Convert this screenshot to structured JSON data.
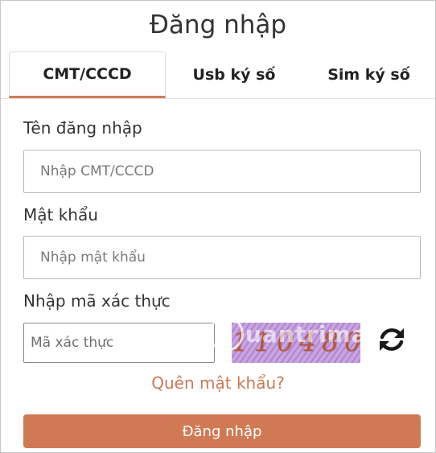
{
  "header": {
    "title": "Đăng nhập"
  },
  "tabs": [
    {
      "label": "CMT/CCCD",
      "active": true
    },
    {
      "label": "Usb ký số",
      "active": false
    },
    {
      "label": "Sim ký số",
      "active": false
    }
  ],
  "form": {
    "username": {
      "label": "Tên đăng nhập",
      "placeholder": "Nhập CMT/CCCD",
      "value": ""
    },
    "password": {
      "label": "Mật khẩu",
      "placeholder": "Nhập mật khẩu",
      "value": ""
    },
    "captcha": {
      "label": "Nhập mã xác thực",
      "placeholder": "Mã xác thực",
      "value": "",
      "image_text": "110480",
      "refresh_icon": "refresh-icon"
    },
    "forgot_link": "Quên mật khẩu?",
    "submit_label": "Đăng nhập"
  },
  "watermark": {
    "text": "uantrimang"
  },
  "colors": {
    "accent": "#d07a55",
    "link": "#c97a55",
    "captcha_bg": "#c9a3dc",
    "captcha_text": "#b4573e"
  }
}
